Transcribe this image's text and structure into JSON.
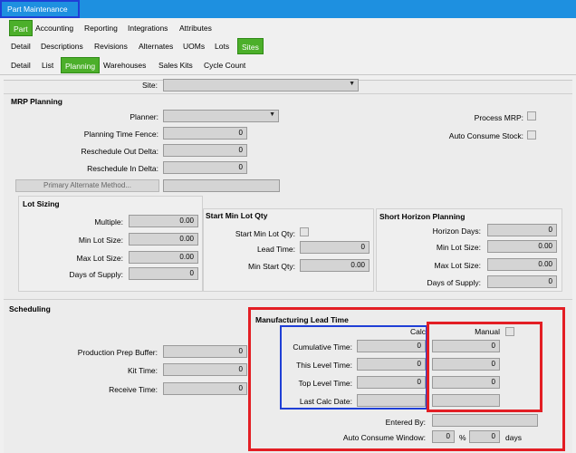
{
  "window": {
    "title": "Part Maintenance"
  },
  "tabs_main": [
    "Part",
    "Accounting",
    "Reporting",
    "Integrations",
    "Attributes"
  ],
  "tabs_sub": [
    "Detail",
    "Descriptions",
    "Revisions",
    "Alternates",
    "UOMs",
    "Lots",
    "Sites"
  ],
  "tabs_site": [
    "Detail",
    "List",
    "Planning",
    "Warehouses",
    "Sales Kits",
    "Cycle Count"
  ],
  "site": {
    "label": "Site:",
    "value": ""
  },
  "mrp": {
    "title": "MRP Planning",
    "planner_label": "Planner:",
    "planning_fence_label": "Planning Time Fence:",
    "planning_fence_value": "0",
    "reschedule_out_label": "Reschedule Out Delta:",
    "reschedule_out_value": "0",
    "reschedule_in_label": "Reschedule In Delta:",
    "reschedule_in_value": "0",
    "primary_alt_button": "Primary Alternate Method...",
    "process_mrp_label": "Process MRP:",
    "auto_consume_label": "Auto Consume Stock:"
  },
  "lot_sizing": {
    "title": "Lot Sizing",
    "multiple_label": "Multiple:",
    "multiple_value": "0.00",
    "min_lot_label": "Min Lot Size:",
    "min_lot_value": "0.00",
    "max_lot_label": "Max Lot Size:",
    "max_lot_value": "0.00",
    "days_supply_label": "Days of Supply:",
    "days_supply_value": "0"
  },
  "start_min": {
    "title": "Start Min Lot Qty",
    "start_min_label": "Start Min Lot Qty:",
    "lead_time_label": "Lead Time:",
    "lead_time_value": "0",
    "min_start_label": "Min Start Qty:",
    "min_start_value": "0.00"
  },
  "short_horizon": {
    "title": "Short Horizon Planning",
    "horizon_days_label": "Horizon Days:",
    "horizon_days_value": "0",
    "min_lot_label": "Min Lot Size:",
    "min_lot_value": "0.00",
    "max_lot_label": "Max Lot Size:",
    "max_lot_value": "0.00",
    "days_supply_label": "Days of Supply:",
    "days_supply_value": "0"
  },
  "scheduling": {
    "title": "Scheduling",
    "prep_buffer_label": "Production Prep Buffer:",
    "prep_buffer_value": "0",
    "kit_time_label": "Kit Time:",
    "kit_time_value": "0",
    "receive_time_label": "Receive Time:",
    "receive_time_value": "0"
  },
  "mlt": {
    "title": "Manufacturing Lead Time",
    "calc_label": "Calc",
    "manual_label": "Manual",
    "cumulative_label": "Cumulative Time:",
    "cumulative_calc": "0",
    "cumulative_manual": "0",
    "this_level_label": "This Level Time:",
    "this_level_calc": "0",
    "this_level_manual": "0",
    "top_level_label": "Top Level Time:",
    "top_level_calc": "0",
    "top_level_manual": "0",
    "last_calc_label": "Last Calc Date:",
    "entered_by_label": "Entered By:",
    "auto_window_label": "Auto Consume Window:",
    "auto_window_from": "0",
    "auto_window_to": "0",
    "percent": "%",
    "days": "days"
  },
  "colors": {
    "titlebar": "#1e90e0",
    "active_tab": "#4caf2a",
    "highlight_blue": "#1f3fd6",
    "highlight_red": "#e31e24"
  }
}
